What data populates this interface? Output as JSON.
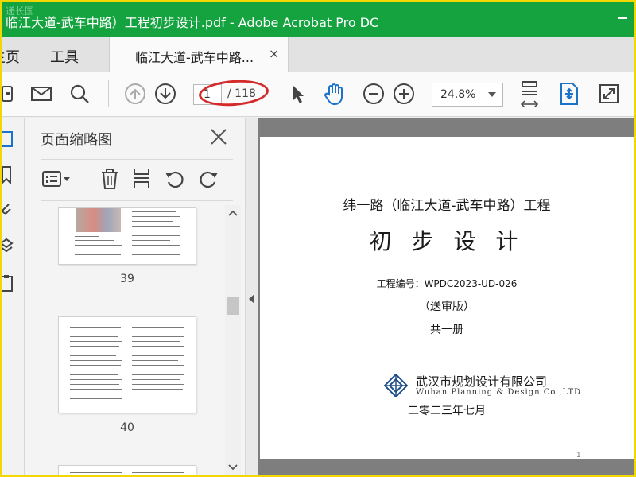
{
  "window": {
    "title": "临江大道-武车中路）工程初步设计.pdf - Adobe Acrobat Pro DC",
    "watermark": "递长国"
  },
  "menu": {
    "home": "主页",
    "tools": "工具"
  },
  "tab": {
    "label": "临江大道-武车中路...",
    "close": "×"
  },
  "toolbar": {
    "page_current": "1",
    "page_total": "/ 118",
    "zoom": "24.8%"
  },
  "panel": {
    "title": "页面缩略图",
    "thumbnails": [
      {
        "page": "39"
      },
      {
        "page": "40"
      }
    ]
  },
  "document": {
    "title_line": "纬一路（临江大道-武车中路）工程",
    "subtitle": "初 步 设 计",
    "project_no": "工程编号：WPDC2023-UD-026",
    "review": "（送审版）",
    "volume": "共一册",
    "company_cn": "武汉市规划设计有限公司",
    "company_en": "Wuhan Planning & Design Co.,LTD",
    "date": "二零二三年七月",
    "page_num": "1"
  },
  "colors": {
    "titlebar": "#14a33f",
    "accent_blue": "#1a73c9",
    "annotation_red": "#d42a2a"
  }
}
